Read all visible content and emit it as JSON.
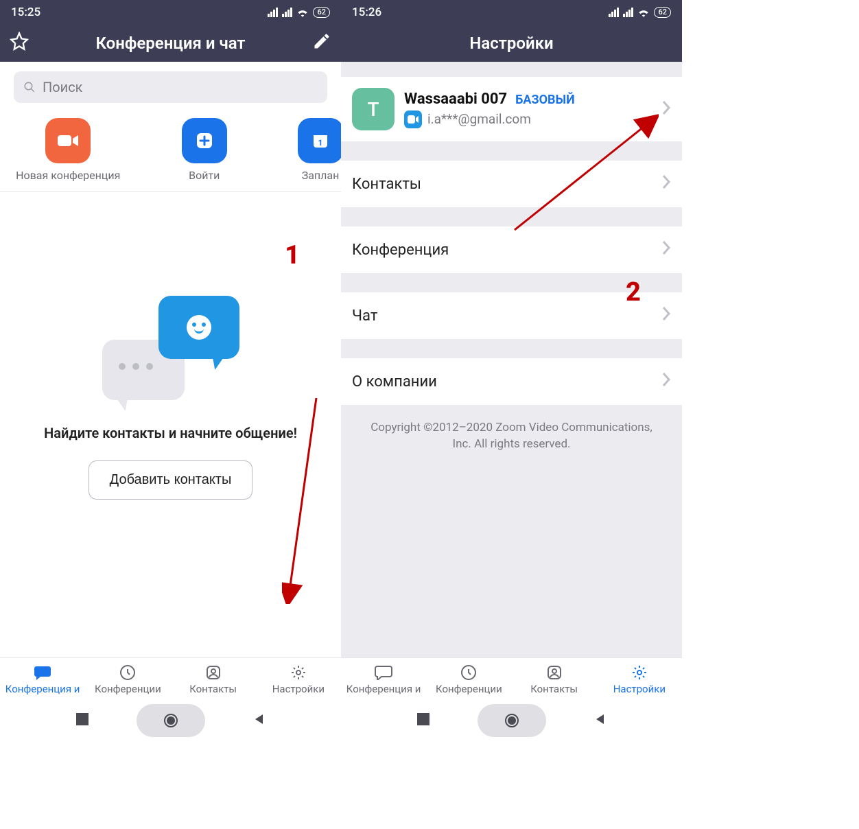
{
  "screen1": {
    "status": {
      "time": "15:25",
      "battery": "62"
    },
    "header": {
      "title": "Конференция и чат"
    },
    "search": {
      "placeholder": "Поиск"
    },
    "actions": {
      "new_meeting": "Новая конференция",
      "join": "Войти",
      "schedule": "Заплан"
    },
    "empty": {
      "text": "Найдите контакты и начните общение!",
      "button": "Добавить контакты"
    },
    "tabs": {
      "chat": "Конференция и",
      "meetings": "Конференции",
      "contacts": "Контакты",
      "settings": "Настройки"
    },
    "annotation_number": "1"
  },
  "screen2": {
    "status": {
      "time": "15:26",
      "battery": "62"
    },
    "header": {
      "title": "Настройки"
    },
    "profile": {
      "avatar_letter": "T",
      "name": "Wassaaabi 007",
      "plan_badge": "БАЗОВЫЙ",
      "email": "i.a***@gmail.com"
    },
    "items": {
      "contacts": "Контакты",
      "conference": "Конференция",
      "chat": "Чат",
      "about": "О компании"
    },
    "copyright": "Copyright ©2012–2020 Zoom Video Communications, Inc. All rights reserved.",
    "tabs": {
      "chat": "Конференция и",
      "meetings": "Конференции",
      "contacts": "Контакты",
      "settings": "Настройки"
    },
    "annotation_number": "2"
  }
}
